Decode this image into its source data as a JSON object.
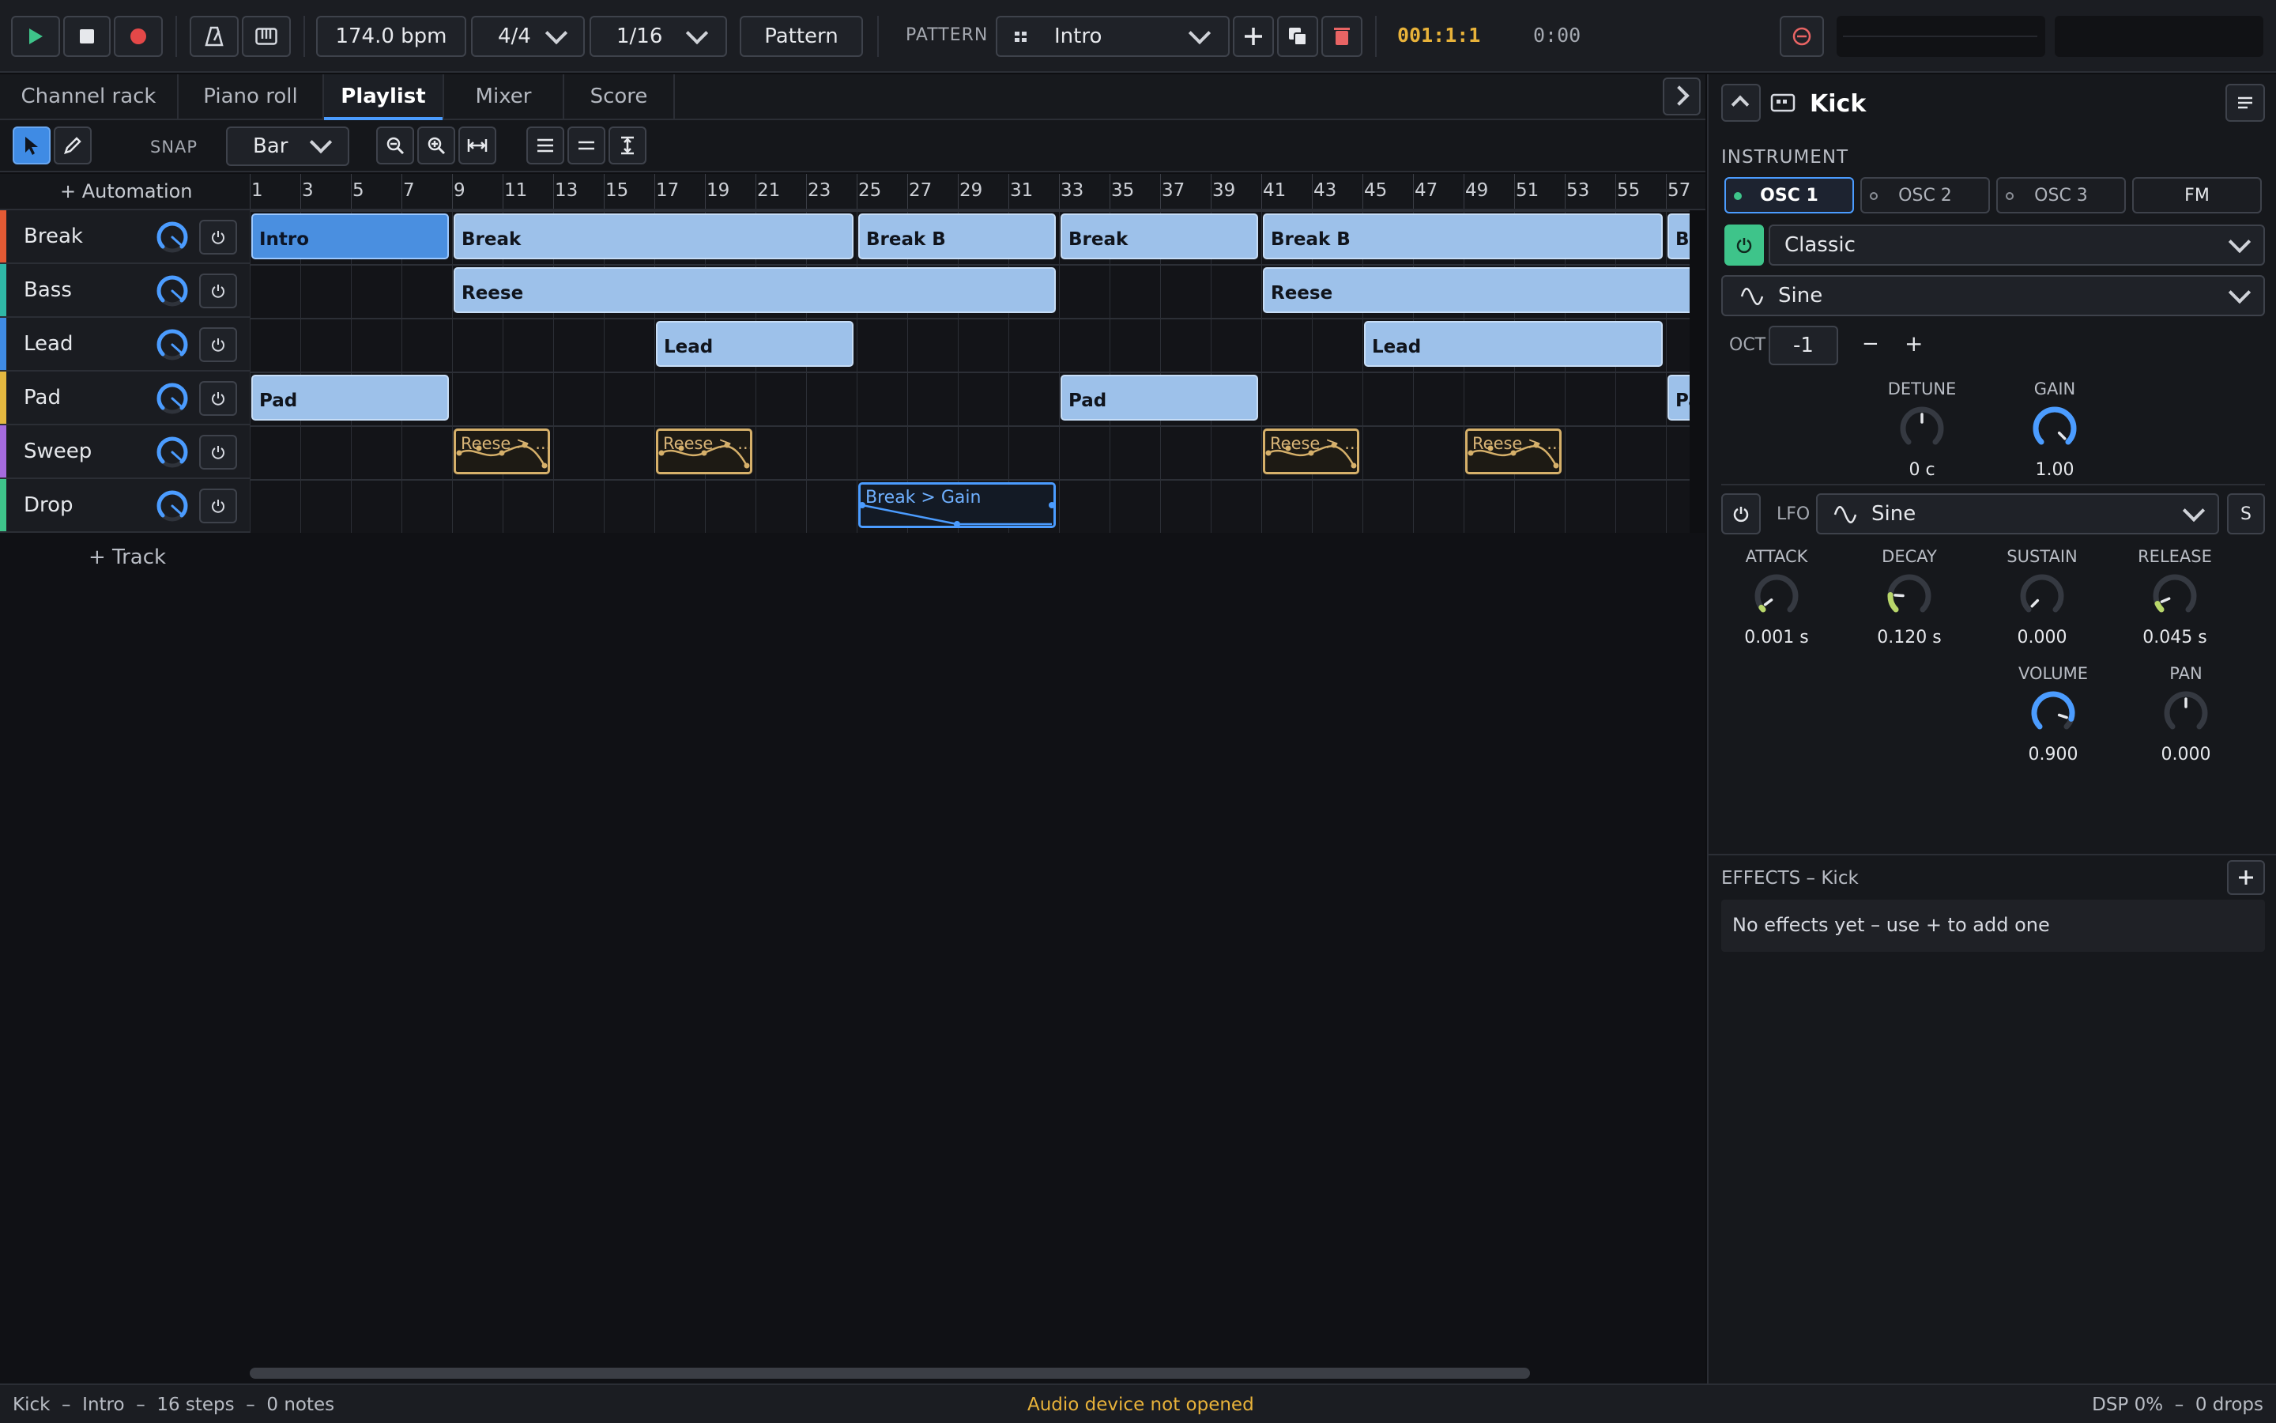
{
  "transport": {
    "bpm": "174.0 bpm",
    "time_signature": "4/4",
    "snap_step": "1/16",
    "mode_button": "Pattern",
    "pattern_label": "PATTERN",
    "pattern_name": "Intro",
    "position": "001:1:1",
    "time": "0:00",
    "accent_color": "#4b9cff"
  },
  "tabs": [
    {
      "label": "Channel rack"
    },
    {
      "label": "Piano roll"
    },
    {
      "label": "Playlist",
      "active": true
    },
    {
      "label": "Mixer"
    },
    {
      "label": "Score"
    }
  ],
  "toolbar": {
    "snap_label": "SNAP",
    "snap_value": "Bar"
  },
  "playlist": {
    "add_automation": "+ Automation",
    "add_track": "+ Track",
    "bars": [
      "1",
      "3",
      "5",
      "7",
      "9",
      "11",
      "13",
      "15",
      "17",
      "19",
      "21",
      "23",
      "25",
      "27",
      "29",
      "31",
      "33",
      "35",
      "37",
      "39",
      "41",
      "43",
      "45",
      "47",
      "49",
      "51",
      "53",
      "55",
      "57"
    ],
    "tracks": [
      {
        "name": "Break",
        "color": "#e35a34"
      },
      {
        "name": "Bass",
        "color": "#2fb8a6"
      },
      {
        "name": "Lead",
        "color": "#3f8be4"
      },
      {
        "name": "Pad",
        "color": "#e4b840"
      },
      {
        "name": "Sweep",
        "color": "#a56bde"
      },
      {
        "name": "Drop",
        "color": "#3ec48a"
      }
    ],
    "clips": [
      {
        "track": 0,
        "start": 1,
        "len": 8,
        "label": "Intro",
        "kind": "sel"
      },
      {
        "track": 0,
        "start": 9,
        "len": 16,
        "label": "Break",
        "kind": "pat"
      },
      {
        "track": 0,
        "start": 25,
        "len": 8,
        "label": "Break B",
        "kind": "pat"
      },
      {
        "track": 0,
        "start": 33,
        "len": 8,
        "label": "Break",
        "kind": "pat"
      },
      {
        "track": 0,
        "start": 41,
        "len": 16,
        "label": "Break B",
        "kind": "pat"
      },
      {
        "track": 0,
        "start": 57,
        "len": 8,
        "label": "Break",
        "kind": "pat"
      },
      {
        "track": 1,
        "start": 9,
        "len": 24,
        "label": "Reese",
        "kind": "pat"
      },
      {
        "track": 1,
        "start": 41,
        "len": 24,
        "label": "Reese",
        "kind": "pat"
      },
      {
        "track": 2,
        "start": 17,
        "len": 8,
        "label": "Lead",
        "kind": "pat"
      },
      {
        "track": 2,
        "start": 45,
        "len": 12,
        "label": "Lead",
        "kind": "pat"
      },
      {
        "track": 3,
        "start": 1,
        "len": 8,
        "label": "Pad",
        "kind": "pat"
      },
      {
        "track": 3,
        "start": 33,
        "len": 8,
        "label": "Pad",
        "kind": "pat"
      },
      {
        "track": 3,
        "start": 57,
        "len": 8,
        "label": "Pad",
        "kind": "pat"
      },
      {
        "track": 4,
        "start": 9,
        "len": 4,
        "label": "Reese > ...",
        "kind": "auto"
      },
      {
        "track": 4,
        "start": 17,
        "len": 4,
        "label": "Reese > ...",
        "kind": "auto"
      },
      {
        "track": 4,
        "start": 41,
        "len": 4,
        "label": "Reese > ...",
        "kind": "auto"
      },
      {
        "track": 4,
        "start": 49,
        "len": 4,
        "label": "Reese > ...",
        "kind": "auto"
      },
      {
        "track": 5,
        "start": 25,
        "len": 8,
        "label": "Break > Gain",
        "kind": "autob"
      }
    ]
  },
  "instrument": {
    "name": "Kick",
    "section_label": "INSTRUMENT",
    "oscillators": [
      {
        "label": "OSC 1",
        "active": true
      },
      {
        "label": "OSC 2"
      },
      {
        "label": "OSC 3"
      },
      {
        "label": "FM"
      }
    ],
    "engine": "Classic",
    "waveform": "Sine",
    "oct_label": "OCT",
    "oct_value": "-1",
    "oct_minus": "−",
    "oct_plus": "+",
    "detune": {
      "label": "DETUNE",
      "value": "0 c"
    },
    "gain": {
      "label": "GAIN",
      "value": "1.00"
    },
    "lfo_label": "LFO",
    "lfo_wave": "Sine",
    "lfo_sync": "S",
    "envelope": [
      {
        "label": "ATTACK",
        "value": "0.001 s"
      },
      {
        "label": "DECAY",
        "value": "0.120 s"
      },
      {
        "label": "SUSTAIN",
        "value": "0.000"
      },
      {
        "label": "RELEASE",
        "value": "0.045 s"
      }
    ],
    "volume": {
      "label": "VOLUME",
      "value": "0.900"
    },
    "pan": {
      "label": "PAN",
      "value": "0.000"
    },
    "effects_title": "EFFECTS – Kick",
    "effects_empty": "No effects yet – use + to add one"
  },
  "status": {
    "left": "Kick  –  Intro  –  16 steps  –  0 notes",
    "center": "Audio device not opened",
    "right": "DSP 0%  –  0 drops",
    "warning_color": "#e8b23a"
  }
}
